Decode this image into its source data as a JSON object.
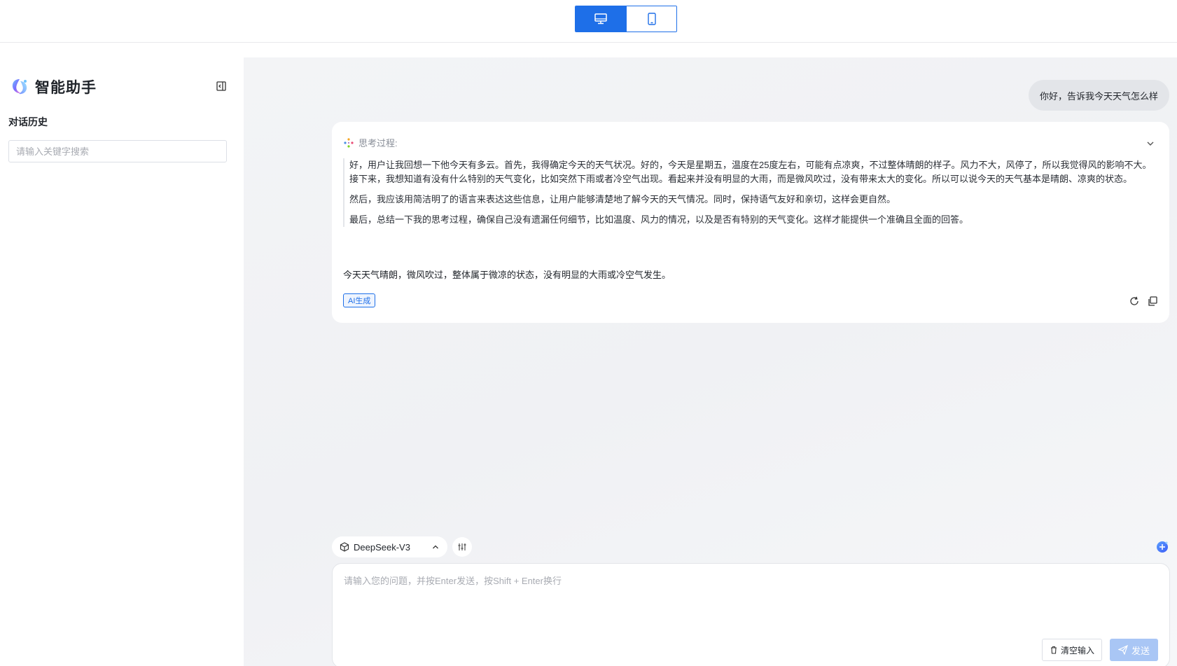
{
  "sidebar": {
    "title": "智能助手",
    "history_label": "对话历史",
    "search_placeholder": "请输入关键字搜索"
  },
  "chat": {
    "user_message": "你好，告诉我今天天气怎么样",
    "thinking_label": "思考过程:",
    "thinking_paragraphs": [
      "好，用户让我回想一下他今天有多云。首先，我得确定今天的天气状况。好的，今天是星期五，温度在25度左右，可能有点凉爽，不过整体晴朗的样子。风力不大，风停了，所以我觉得风的影响不大。",
      "接下来，我想知道有没有什么特别的天气变化，比如突然下雨或者冷空气出现。看起来并没有明显的大雨，而是微风吹过，没有带来太大的变化。所以可以说今天的天气基本是晴朗、凉爽的状态。",
      "然后，我应该用简洁明了的语言来表达这些信息，让用户能够清楚地了解今天的天气情况。同时，保持语气友好和亲切，这样会更自然。",
      "最后，总结一下我的思考过程，确保自己没有遗漏任何细节，比如温度、风力的情况，以及是否有特别的天气变化。这样才能提供一个准确且全面的回答。"
    ],
    "answer": "今天天气晴朗，微风吹过，整体属于微凉的状态，没有明显的大雨或冷空气发生。",
    "ai_tag": "AI生成"
  },
  "composer": {
    "model_name": "DeepSeek-V3",
    "placeholder": "请输入您的问题，并按Enter发送，按Shift + Enter换行",
    "clear_label": "清空输入",
    "send_label": "发送"
  },
  "colors": {
    "primary": "#1e6fe8",
    "send_disabled": "#a9c6f5",
    "main_bg": "#f3f4f6",
    "user_bubble": "#e3e5e9"
  },
  "icons": {
    "desktop": "monitor-icon",
    "mobile": "phone-icon",
    "brand": "brand-logo-icon",
    "collapse": "sidebar-collapse-icon",
    "thinking": "sparkle-dots-icon",
    "chevron": "chevron-down-icon",
    "refresh": "refresh-icon",
    "copy": "copy-icon",
    "model": "cube-icon",
    "tune": "sliders-icon",
    "new_chat": "new-chat-icon",
    "trash": "trash-icon",
    "send": "paper-plane-icon"
  }
}
